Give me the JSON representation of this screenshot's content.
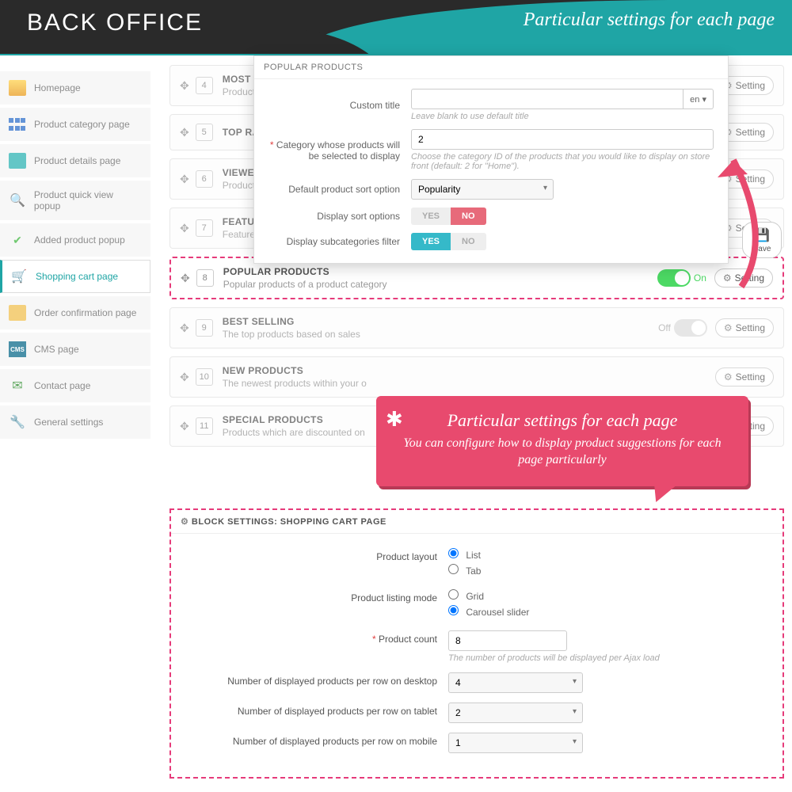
{
  "header": {
    "title": "BACK OFFICE",
    "subtitle": "Particular settings for each page"
  },
  "sidebar": {
    "items": [
      {
        "label": "Homepage"
      },
      {
        "label": "Product category page"
      },
      {
        "label": "Product details page"
      },
      {
        "label": "Product quick view popup"
      },
      {
        "label": "Added product popup"
      },
      {
        "label": "Shopping cart page"
      },
      {
        "label": "Order confirmation page"
      },
      {
        "label": "CMS page"
      },
      {
        "label": "Contact page"
      },
      {
        "label": "General settings"
      }
    ]
  },
  "fp": {
    "title": "POPULAR PRODUCTS",
    "custom_title_label": "Custom title",
    "custom_title_value": "",
    "custom_title_hint": "Leave blank to use default title",
    "lang": "en",
    "cat_label": "Category whose products will be selected to display",
    "cat_value": "2",
    "cat_hint": "Choose the category ID of the products that you would like to display on store front (default: 2 for \"Home\").",
    "sort_label": "Default product sort option",
    "sort_value": "Popularity",
    "dso_label": "Display sort options",
    "dso_yes": "YES",
    "dso_no": "NO",
    "dsf_label": "Display subcategories filter",
    "dsf_yes": "YES",
    "dsf_no": "NO",
    "save": "Save"
  },
  "rows": [
    {
      "num": "4",
      "title": "MOST VIEWE",
      "desc": "Products whi"
    },
    {
      "num": "5",
      "title": "TOP RATED P",
      "desc": ""
    },
    {
      "num": "6",
      "title": "VIEWED PRO",
      "desc": "Products whi"
    },
    {
      "num": "7",
      "title": "FEATURED PR",
      "desc": "Featured pro"
    },
    {
      "num": "8",
      "title": "POPULAR PRODUCTS",
      "desc": "Popular products of a product category",
      "on": "On"
    },
    {
      "num": "9",
      "title": "BEST SELLING",
      "desc": "The top products based on sales",
      "off": "Off"
    },
    {
      "num": "10",
      "title": "NEW PRODUCTS",
      "desc": "The newest products within your o"
    },
    {
      "num": "11",
      "title": "SPECIAL PRODUCTS",
      "desc": "Products which are discounted on"
    }
  ],
  "btn_setting": "Setting",
  "callout": {
    "title": "Particular settings for each page",
    "sub": "You can configure how to display product suggestions for each page particularly"
  },
  "bset": {
    "head": "BLOCK SETTINGS: SHOPPING CART PAGE",
    "layout_label": "Product layout",
    "layout_list": "List",
    "layout_tab": "Tab",
    "mode_label": "Product listing mode",
    "mode_grid": "Grid",
    "mode_carousel": "Carousel slider",
    "count_label": "Product count",
    "count_value": "8",
    "count_hint": "The number of products will be displayed per Ajax load",
    "desk_label": "Number of displayed products per row on desktop",
    "desk_value": "4",
    "tab_label": "Number of displayed products per row on tablet",
    "tab_value": "2",
    "mob_label": "Number of displayed products per row on mobile",
    "mob_value": "1"
  }
}
